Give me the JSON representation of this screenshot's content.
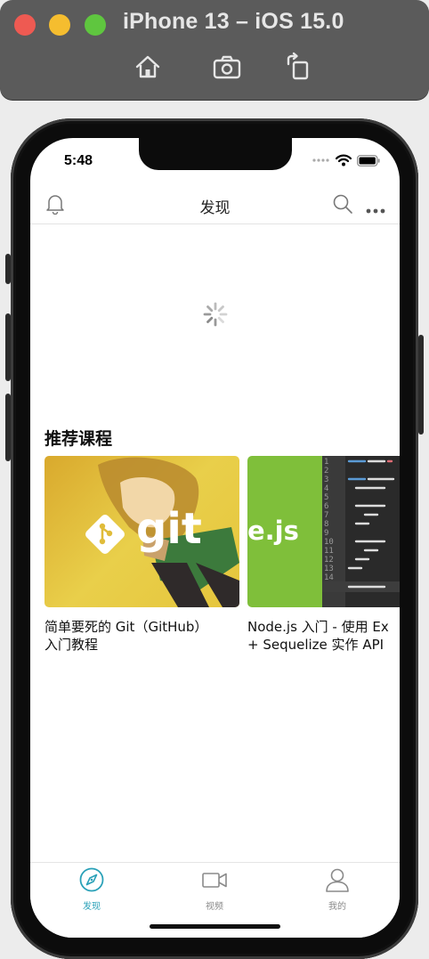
{
  "simulator": {
    "title": "iPhone 13 – iOS 15.0",
    "buttons": [
      "home-icon",
      "screenshot-icon",
      "rotate-icon"
    ]
  },
  "status_bar": {
    "time": "5:48"
  },
  "navbar": {
    "title": "发现",
    "left_icon": "bell-icon",
    "right_icons": [
      "search-icon",
      "more-icon"
    ]
  },
  "loading": {
    "icon": "spinner-icon"
  },
  "recommended": {
    "title": "推荐课程",
    "courses": [
      {
        "name": "简单要死的 Git（GitHub）\n入门教程",
        "thumb_text": "git"
      },
      {
        "name": "Node.js 入门 - 使用 Ex\n+ Sequelize 实作 API",
        "thumb_text": "e.js"
      }
    ]
  },
  "tabbar": {
    "tabs": [
      {
        "label": "发现",
        "icon": "compass-icon",
        "active": true
      },
      {
        "label": "视频",
        "icon": "video-icon",
        "active": false
      },
      {
        "label": "我的",
        "icon": "user-icon",
        "active": false
      }
    ]
  },
  "colors": {
    "active_tab": "#2aa1b8",
    "inactive_tab": "#8a8a8a",
    "git_bg": "#e4c23f",
    "node_bg": "#7fbf3a",
    "code_bg": "#2a2a2a"
  }
}
